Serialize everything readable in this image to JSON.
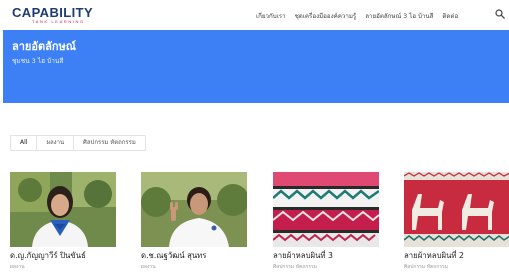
{
  "brand": {
    "name": "CAPABILITY",
    "tagline": "TANK LEARNING"
  },
  "nav": {
    "items": [
      "เกี่ยวกับเรา",
      "ชุดเครื่องมือองค์ความรู้",
      "ลายอัตลักษณ์ 3 ไฮ บ้านสี",
      "ติดต่อ"
    ]
  },
  "hero": {
    "title": "ลายอัตลักษณ์",
    "subtitle": "ชุมชน 3 ไฮ บ้านสี",
    "color": "#3d7ff5"
  },
  "filters": {
    "all": "All",
    "work": "ผลงาน",
    "art": "ศิลปกรรม หัตถกรรม"
  },
  "cards": [
    {
      "title": "ด.ญ.กัญญาวีร์ ปินขันธ์",
      "category": "ผลงาน"
    },
    {
      "title": "ด.ช.ณฐวัฒน์ สุนทร",
      "category": "ผลงาน"
    },
    {
      "title": "ลายผ้าหลบผินที่ 3",
      "category": "ศิลปกรรม หัตถกรรม"
    },
    {
      "title": "ลายผ้าหลบผินที่ 2",
      "category": "ศิลปกรรม หัตถกรรม"
    }
  ]
}
